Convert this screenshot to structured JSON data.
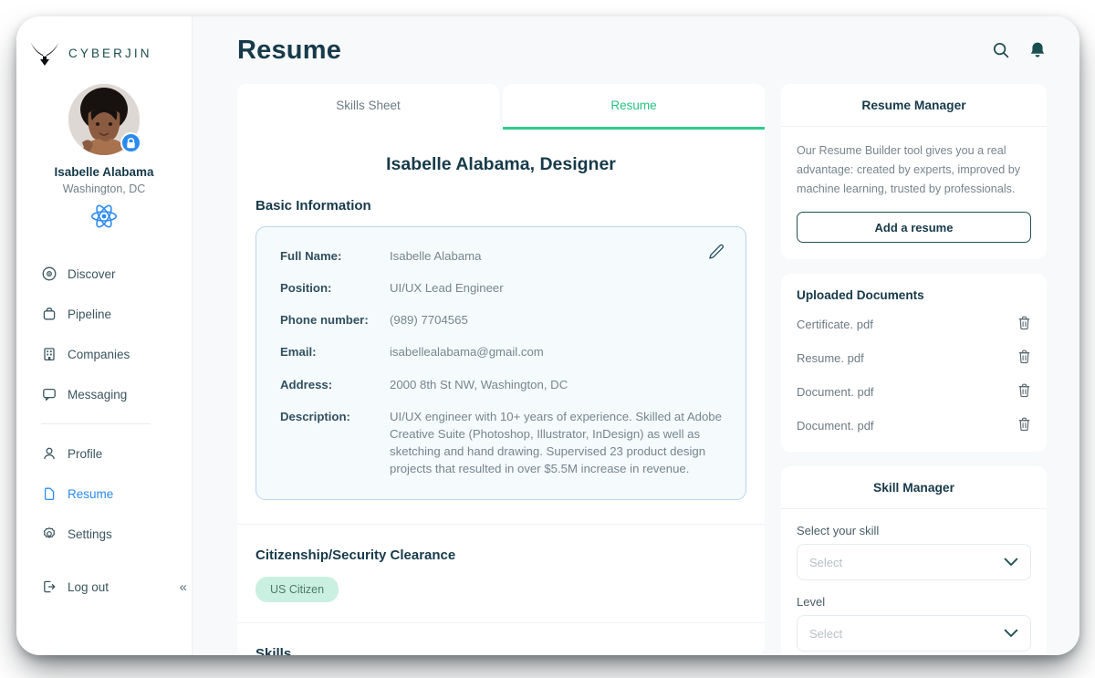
{
  "brand": {
    "name": "CYBERJIN",
    "logo_icon": "horns-logo-icon"
  },
  "profile": {
    "name": "Isabelle Alabama",
    "location": "Washington, DC",
    "lock_icon": "lock-icon",
    "atom_icon": "atom-icon"
  },
  "sidebar": {
    "items": [
      {
        "label": "Discover",
        "icon": "compass-icon",
        "active": false
      },
      {
        "label": "Pipeline",
        "icon": "briefcase-icon",
        "active": false
      },
      {
        "label": "Companies",
        "icon": "building-icon",
        "active": false
      },
      {
        "label": "Messaging",
        "icon": "chat-icon",
        "active": false
      }
    ],
    "items2": [
      {
        "label": "Profile",
        "icon": "user-icon",
        "active": false
      },
      {
        "label": "Resume",
        "icon": "document-icon",
        "active": true
      },
      {
        "label": "Settings",
        "icon": "gear-icon",
        "active": false
      }
    ],
    "logout": {
      "label": "Log out",
      "icon": "logout-icon"
    },
    "collapse_icon": "chevron-double-left-icon"
  },
  "header": {
    "title": "Resume",
    "search_icon": "search-icon",
    "bell_icon": "bell-icon"
  },
  "tabs": [
    {
      "label": "Skills Sheet",
      "active": false
    },
    {
      "label": "Resume",
      "active": true
    }
  ],
  "resume": {
    "heading": "Isabelle Alabama, Designer",
    "basic_info_title": "Basic Information",
    "edit_icon": "pencil-icon",
    "fields": [
      {
        "label": "Full Name:",
        "value": "Isabelle Alabama"
      },
      {
        "label": "Position:",
        "value": "UI/UX Lead Engineer"
      },
      {
        "label": "Phone number:",
        "value": "(989) 7704565"
      },
      {
        "label": "Email:",
        "value": "isabellealabama@gmail.com"
      },
      {
        "label": "Address:",
        "value": "2000 8th St NW, Washington, DC"
      },
      {
        "label": "Description:",
        "value": "UI/UX engineer with 10+ years of experience. Skilled at Adobe Creative Suite (Photoshop, Illustrator, InDesign) as well as sketching and hand drawing. Supervised 23 product design projects that resulted in over $5.5M increase in revenue."
      }
    ],
    "citizenship_title": "Citizenship/Security Clearance",
    "citizenship_chip": "US Citizen",
    "skills_title": "Skills"
  },
  "resume_manager": {
    "title": "Resume Manager",
    "description": "Our Resume Builder tool gives you a real advantage: created by experts, improved by machine learning, trusted by professionals.",
    "button": "Add a resume"
  },
  "uploaded_documents": {
    "title": "Uploaded Documents",
    "trash_icon": "trash-icon",
    "items": [
      {
        "name": "Certificate. pdf"
      },
      {
        "name": "Resume. pdf"
      },
      {
        "name": "Document. pdf"
      },
      {
        "name": "Document. pdf"
      }
    ]
  },
  "skill_manager": {
    "title": "Skill Manager",
    "skill_label": "Select your skill",
    "skill_placeholder": "Select",
    "level_label": "Level",
    "level_placeholder": "Select",
    "chevron_icon": "chevron-down-icon"
  },
  "colors": {
    "accent_green": "#2fcc8b",
    "dark_teal": "#173a4a",
    "link_blue": "#2a8af0",
    "chip_green_bg": "#c9f0e0",
    "card_blue_border": "#b8d4ee",
    "page_bg": "#f7f9fa"
  }
}
